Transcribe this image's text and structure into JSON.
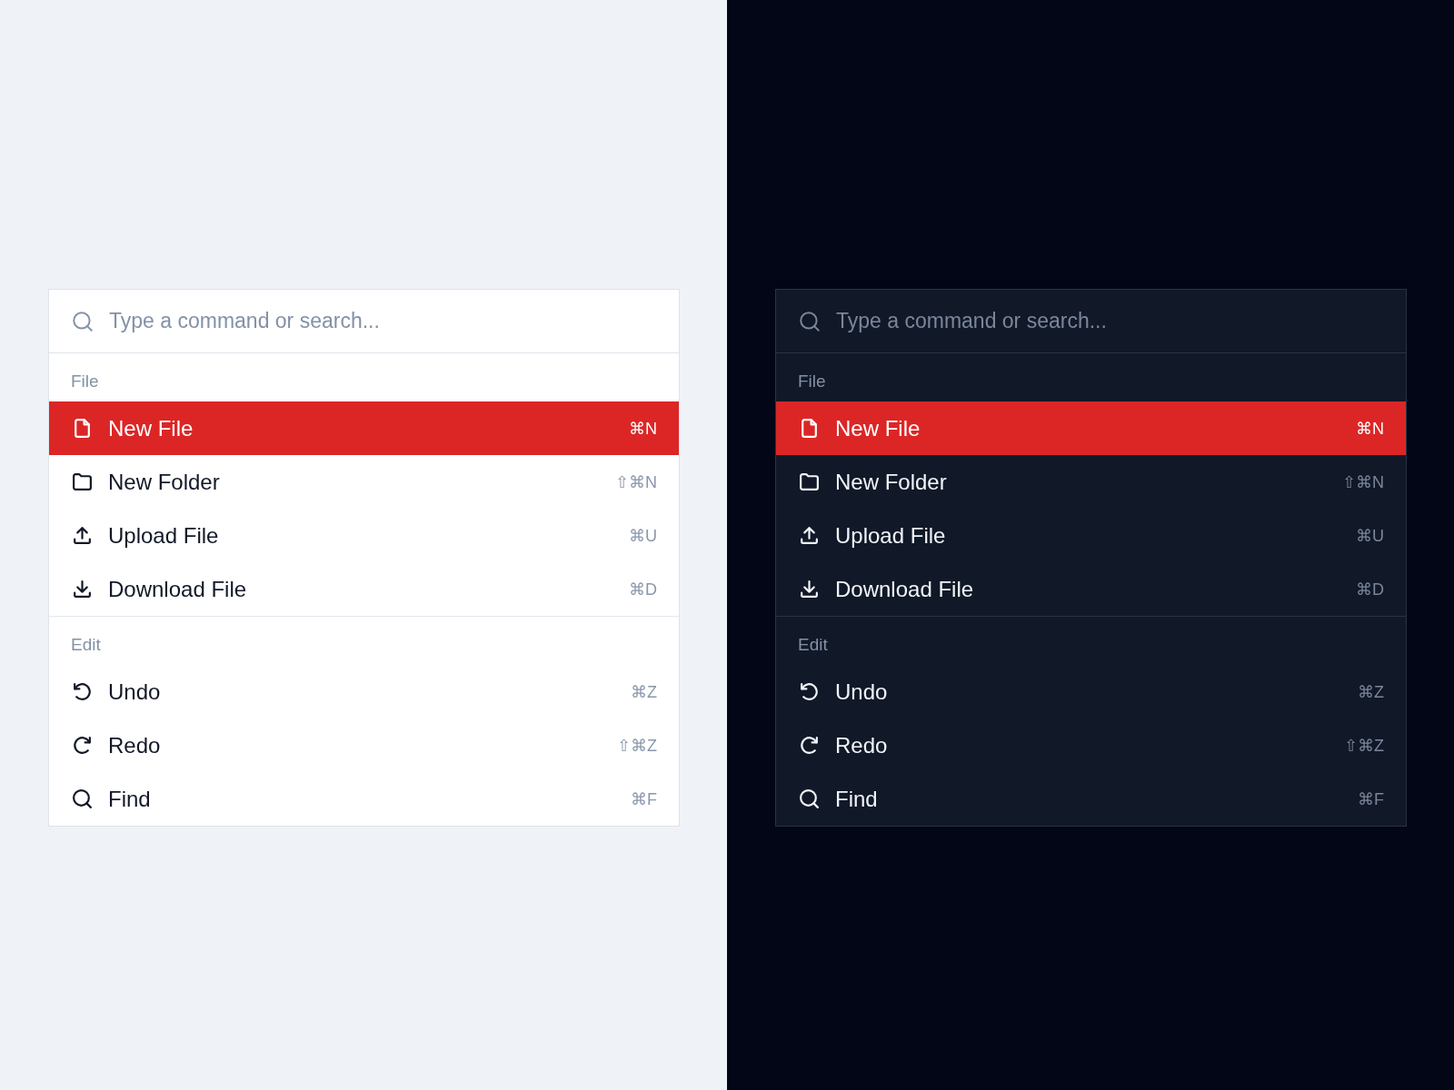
{
  "panels": [
    {
      "kind": "light",
      "search": {
        "placeholder": "Type a command or search..."
      },
      "groups": [
        {
          "title": "File",
          "items": [
            {
              "kind": "file",
              "label": "New File",
              "shortcut": "⌘N",
              "selected": true
            },
            {
              "kind": "folder",
              "label": "New Folder",
              "shortcut": "⇧⌘N",
              "selected": false
            },
            {
              "kind": "upload",
              "label": "Upload File",
              "shortcut": "⌘U",
              "selected": false
            },
            {
              "kind": "download",
              "label": "Download File",
              "shortcut": "⌘D",
              "selected": false
            }
          ]
        },
        {
          "title": "Edit",
          "items": [
            {
              "kind": "undo",
              "label": "Undo",
              "shortcut": "⌘Z",
              "selected": false
            },
            {
              "kind": "redo",
              "label": "Redo",
              "shortcut": "⇧⌘Z",
              "selected": false
            },
            {
              "kind": "find",
              "label": "Find",
              "shortcut": "⌘F",
              "selected": false
            }
          ]
        }
      ]
    },
    {
      "kind": "dark",
      "search": {
        "placeholder": "Type a command or search..."
      },
      "groups": [
        {
          "title": "File",
          "items": [
            {
              "kind": "file",
              "label": "New File",
              "shortcut": "⌘N",
              "selected": true
            },
            {
              "kind": "folder",
              "label": "New Folder",
              "shortcut": "⇧⌘N",
              "selected": false
            },
            {
              "kind": "upload",
              "label": "Upload File",
              "shortcut": "⌘U",
              "selected": false
            },
            {
              "kind": "download",
              "label": "Download File",
              "shortcut": "⌘D",
              "selected": false
            }
          ]
        },
        {
          "title": "Edit",
          "items": [
            {
              "kind": "undo",
              "label": "Undo",
              "shortcut": "⌘Z",
              "selected": false
            },
            {
              "kind": "redo",
              "label": "Redo",
              "shortcut": "⇧⌘Z",
              "selected": false
            },
            {
              "kind": "find",
              "label": "Find",
              "shortcut": "⌘F",
              "selected": false
            }
          ]
        }
      ]
    }
  ]
}
